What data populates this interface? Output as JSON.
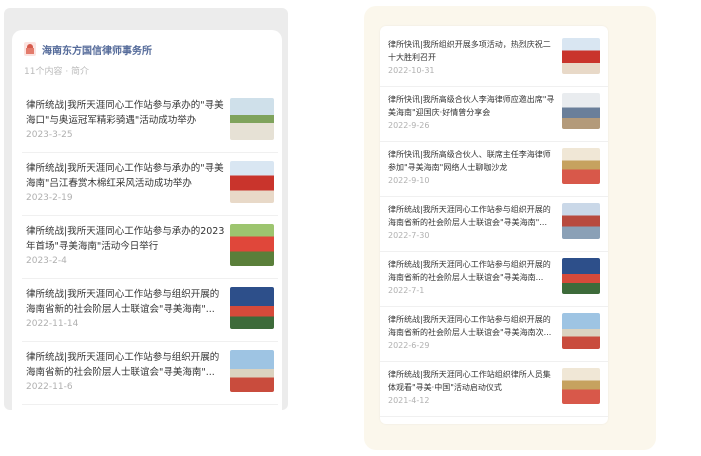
{
  "left": {
    "account_name": "海南东方国信律师事务所",
    "account_meta": "11个内容 · 简介",
    "items": [
      {
        "title": "律所统战|我所天涯同心工作站参与承办的\"寻美海口\"与奥运冠军精彩骑遇\"活动成功举办",
        "date": "2023-3-25",
        "thumb": "pic-park"
      },
      {
        "title": "律所统战|我所天涯同心工作站参与承办的\"寻美海南\"吕江春赏木棉红采风活动成功举办",
        "date": "2023-2-19",
        "thumb": "pic-red"
      },
      {
        "title": "律所统战|我所天涯同心工作站参与承办的2023年首场\"寻美海南\"活动今日举行",
        "date": "2023-2-4",
        "thumb": "pic-group"
      },
      {
        "title": "律所统战|我所天涯同心工作站参与组织开展的海南省新的社会阶层人士联谊会\"寻美海南\"...",
        "date": "2022-11-14",
        "thumb": "pic-stage"
      },
      {
        "title": "律所统战|我所天涯同心工作站参与组织开展的海南省新的社会阶层人士联谊会\"寻美海南\"...",
        "date": "2022-11-6",
        "thumb": "pic-sky"
      }
    ]
  },
  "right": {
    "items": [
      {
        "title": "律所快讯|我所组织开展多项活动，热烈庆祝二十大胜利召开",
        "date": "2022-10-31",
        "thumb": "pic-red"
      },
      {
        "title": "律所快讯|我所高级合伙人李海律师应邀出席\"寻美海南\"迎国庆·好情曾分享会",
        "date": "2022-9-26",
        "thumb": "pic-room"
      },
      {
        "title": "律所快讯|我所高级合伙人、联席主任李海律师参加\"寻美海南\"网络人士聊咖沙龙",
        "date": "2022-9-10",
        "thumb": "pic-meet"
      },
      {
        "title": "律所统战|我所天涯同心工作站参与组织开展的海南省新的社会阶层人士联谊会\"寻美海南\"...",
        "date": "2022-7-30",
        "thumb": "pic-crowd"
      },
      {
        "title": "律所统战|我所天涯同心工作站参与组织开展的海南省新的社会阶层人士联谊会\"寻美海南...",
        "date": "2022-7-1",
        "thumb": "pic-stage"
      },
      {
        "title": "律所统战|我所天涯同心工作站参与组织开展的海南省新的社会阶层人士联谊会\"寻美海南次...",
        "date": "2022-6-29",
        "thumb": "pic-sky"
      },
      {
        "title": "律所统战|我所天涯同心工作站组织律所人员集体观看\"寻美·中国\"活动启动仪式",
        "date": "2021-4-12",
        "thumb": "pic-meet"
      }
    ]
  }
}
